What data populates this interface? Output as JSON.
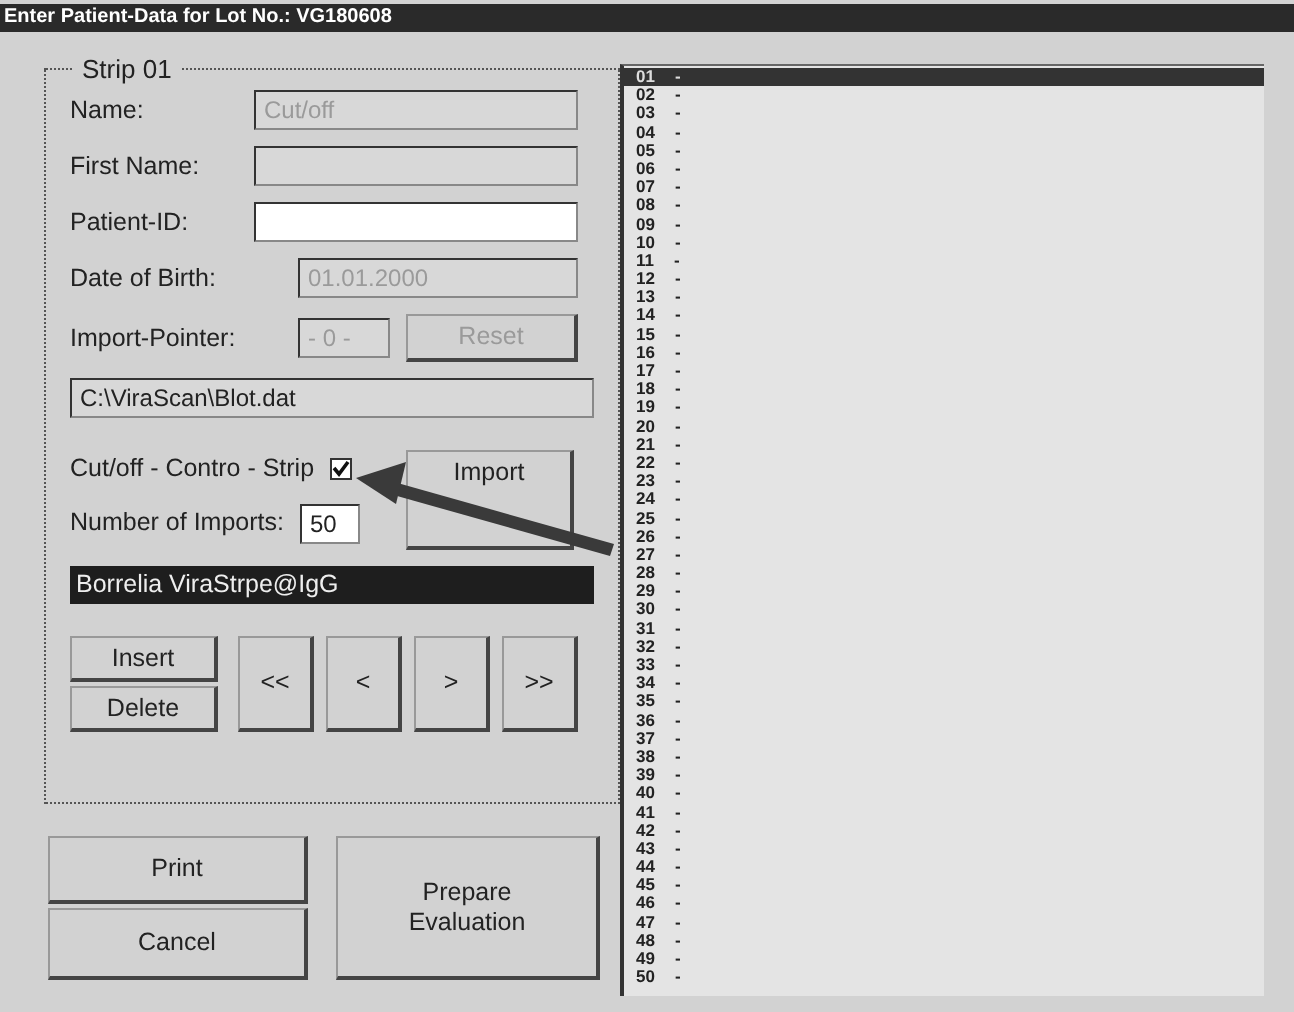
{
  "window": {
    "title": "Enter Patient-Data for Lot No.: VG180608"
  },
  "strip": {
    "legend": "Strip 01",
    "fields": [
      {
        "label": "Name:",
        "value": "Cut/off",
        "disabled": true,
        "kind": "wide"
      },
      {
        "label": "First Name:",
        "disabled": true,
        "kind": "wide"
      },
      {
        "label": "Patient-ID:",
        "disabled": false,
        "kind": "wide"
      },
      {
        "label": "Date of Birth:",
        "value": "01.01.2000",
        "disabled": true,
        "kind": "narrow"
      }
    ],
    "import_pointer": {
      "label": "Import-Pointer:",
      "value": "- 0 -",
      "reset": {
        "label": "Reset",
        "disabled": true
      }
    },
    "path": "C:\\ViraScan\\Blot.dat",
    "control_strip": {
      "label": "Cut/off - Contro  - Strip",
      "checked": true
    },
    "number_of_imports": {
      "label": "Number of Imports:",
      "value": "50"
    },
    "import_button": "Import",
    "test_name": "Borrelia ViraStrpe@IgG",
    "edit_buttons": [
      "Insert",
      "Delete"
    ],
    "nav_buttons": [
      "<<",
      "<",
      ">",
      ">>"
    ]
  },
  "bottom_buttons": {
    "print": "Print",
    "cancel": "Cancel",
    "prepare": "Prepare Evaluation"
  },
  "strips": [
    {
      "number": "01",
      "mark": "-",
      "selected": true
    },
    {
      "number": "02",
      "mark": "-",
      "selected": false
    },
    {
      "number": "03",
      "mark": "-",
      "selected": false
    },
    {
      "number": "04",
      "mark": "-",
      "selected": false
    },
    {
      "number": "05",
      "mark": "-",
      "selected": false
    },
    {
      "number": "06",
      "mark": "-",
      "selected": false
    },
    {
      "number": "07",
      "mark": "-",
      "selected": false
    },
    {
      "number": "08",
      "mark": "-",
      "selected": false
    },
    {
      "number": "09",
      "mark": "-",
      "selected": false
    },
    {
      "number": "10",
      "mark": "-",
      "selected": false
    },
    {
      "number": "11",
      "mark": "-",
      "selected": false
    },
    {
      "number": "12",
      "mark": "-",
      "selected": false
    },
    {
      "number": "13",
      "mark": "-",
      "selected": false
    },
    {
      "number": "14",
      "mark": "-",
      "selected": false
    },
    {
      "number": "15",
      "mark": "-",
      "selected": false
    },
    {
      "number": "16",
      "mark": "-",
      "selected": false
    },
    {
      "number": "17",
      "mark": "-",
      "selected": false
    },
    {
      "number": "18",
      "mark": "-",
      "selected": false
    },
    {
      "number": "19",
      "mark": "-",
      "selected": false
    },
    {
      "number": "20",
      "mark": "-",
      "selected": false
    },
    {
      "number": "21",
      "mark": "-",
      "selected": false
    },
    {
      "number": "22",
      "mark": "-",
      "selected": false
    },
    {
      "number": "23",
      "mark": "-",
      "selected": false
    },
    {
      "number": "24",
      "mark": "-",
      "selected": false
    },
    {
      "number": "25",
      "mark": "-",
      "selected": false
    },
    {
      "number": "26",
      "mark": "-",
      "selected": false
    },
    {
      "number": "27",
      "mark": "-",
      "selected": false
    },
    {
      "number": "28",
      "mark": "-",
      "selected": false
    },
    {
      "number": "29",
      "mark": "-",
      "selected": false
    },
    {
      "number": "30",
      "mark": "-",
      "selected": false
    },
    {
      "number": "31",
      "mark": "-",
      "selected": false
    },
    {
      "number": "32",
      "mark": "-",
      "selected": false
    },
    {
      "number": "33",
      "mark": "-",
      "selected": false
    },
    {
      "number": "34",
      "mark": "-",
      "selected": false
    },
    {
      "number": "35",
      "mark": "-",
      "selected": false
    },
    {
      "number": "36",
      "mark": "-",
      "selected": false
    },
    {
      "number": "37",
      "mark": "-",
      "selected": false
    },
    {
      "number": "38",
      "mark": "-",
      "selected": false
    },
    {
      "number": "39",
      "mark": "-",
      "selected": false
    },
    {
      "number": "40",
      "mark": "-",
      "selected": false
    },
    {
      "number": "41",
      "mark": "-",
      "selected": false
    },
    {
      "number": "42",
      "mark": "-",
      "selected": false
    },
    {
      "number": "43",
      "mark": "-",
      "selected": false
    },
    {
      "number": "44",
      "mark": "-",
      "selected": false
    },
    {
      "number": "45",
      "mark": "-",
      "selected": false
    },
    {
      "number": "46",
      "mark": "-",
      "selected": false
    },
    {
      "number": "47",
      "mark": "-",
      "selected": false
    },
    {
      "number": "48",
      "mark": "-",
      "selected": false
    },
    {
      "number": "49",
      "mark": "-",
      "selected": false
    },
    {
      "number": "50",
      "mark": "-",
      "selected": false
    }
  ]
}
